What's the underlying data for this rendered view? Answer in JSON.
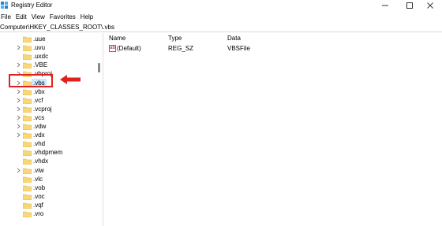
{
  "window": {
    "title": "Registry Editor",
    "controls": [
      "minimize",
      "maximize",
      "close"
    ]
  },
  "menu": {
    "items": [
      "File",
      "Edit",
      "View",
      "Favorites",
      "Help"
    ]
  },
  "address": {
    "path": "Computer\\HKEY_CLASSES_ROOT\\.vbs"
  },
  "tree": {
    "items": [
      {
        "label": ".uue",
        "expandable": false
      },
      {
        "label": ".uvu",
        "expandable": true
      },
      {
        "label": ".uxdc",
        "expandable": false
      },
      {
        "label": ".VBE",
        "expandable": true
      },
      {
        "label": ".vbproj",
        "expandable": true
      },
      {
        "label": ".vbs",
        "expandable": true,
        "selected": true
      },
      {
        "label": ".vbx",
        "expandable": true
      },
      {
        "label": ".vcf",
        "expandable": true
      },
      {
        "label": ".vcproj",
        "expandable": true
      },
      {
        "label": ".vcs",
        "expandable": true
      },
      {
        "label": ".vdw",
        "expandable": true
      },
      {
        "label": ".vdx",
        "expandable": true
      },
      {
        "label": ".vhd",
        "expandable": false
      },
      {
        "label": ".vhdpmem",
        "expandable": false
      },
      {
        "label": ".vhdx",
        "expandable": false
      },
      {
        "label": ".viw",
        "expandable": true
      },
      {
        "label": ".vlc",
        "expandable": false
      },
      {
        "label": ".vob",
        "expandable": false
      },
      {
        "label": ".voc",
        "expandable": false
      },
      {
        "label": ".vqf",
        "expandable": false
      },
      {
        "label": ".vro",
        "expandable": false
      }
    ]
  },
  "values": {
    "columns": [
      "Name",
      "Type",
      "Data"
    ],
    "rows": [
      {
        "icon": "string-value-icon",
        "icon_text": "ab",
        "name": "(Default)",
        "type": "REG_SZ",
        "data": "VBSFile"
      }
    ]
  },
  "colors": {
    "highlight": "#e02020",
    "folder": "#f8d775",
    "selection": "#cce8ff"
  }
}
